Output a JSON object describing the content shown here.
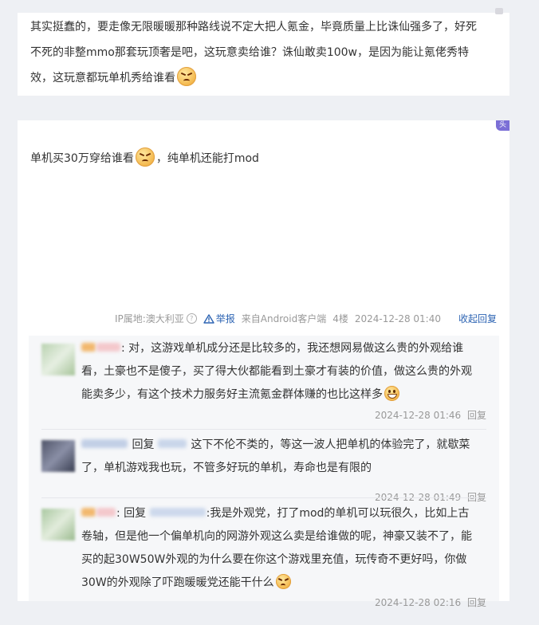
{
  "post1": {
    "line1": "其实挺蠢的，要走像无限暖暖那种路线说不定大把人氪金，毕竟质量上比诛仙强多了，好死",
    "line2": "不死的非整mmo那套玩顶奢是吧，这玩意卖给谁？诛仙敢卖100w，是因为能让氪佬秀特",
    "line3": "效，这玩意都玩单机秀给谁看",
    "emoji_end": "angry-face-emoji"
  },
  "post2": {
    "corner_badge": "头",
    "text_a": "单机买30万穿给谁看",
    "text_b": "，纯单机还能打mod",
    "emoji_mid": "angry-face-emoji",
    "meta": {
      "ip": "IP属地:澳大利亚",
      "report": "举报",
      "source": "来自Android客户端",
      "floor": "4楼",
      "time": "2024-12-28 01:40",
      "collapse": "收起回复"
    }
  },
  "replies": [
    {
      "lines": [
        ": 对，这游戏单机成分还是比较多的，我还想网易做这么贵的外观给谁",
        "看，土豪也不是傻子，买了得大伙都能看到土豪才有装的价值，做这么贵的外观",
        "能卖多少，有这个技术力服务好主流氪金群体赚的也比这样多"
      ],
      "time": "2024-12-28 01:46",
      "reply_label": "回复"
    },
    {
      "lines": [
        "回复",
        "这下不伦不类的，等这一波人把单机的体验完了，就歇菜",
        "了，单机游戏我也玩，不管多好玩的单机，寿命也是有限的"
      ],
      "time": "2024-12-28 01:49",
      "reply_label": "回复"
    },
    {
      "lines": [
        ": 回复",
        ":我是外观党，打了mod的单机可以玩很久，比如上古",
        "卷轴，但是他一个偏单机向的网游外观这么卖是给谁做的呢，神豪又装不了，能",
        "买的起30W50W外观的为什么要在你这个游戏里充值，玩传奇不更好吗，你做",
        "30W的外观除了吓跑暖暖党还能干什么"
      ],
      "time": "2024-12-28 02:16",
      "reply_label": "回复"
    }
  ]
}
